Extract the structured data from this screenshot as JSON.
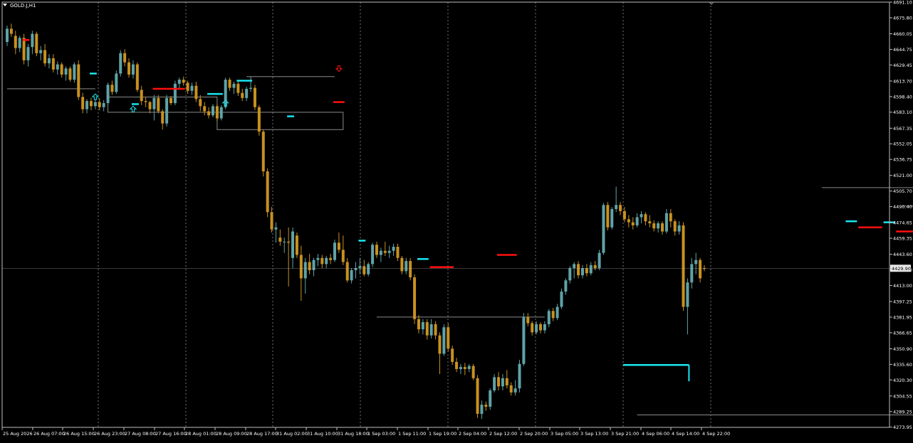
{
  "symbol": "GOLD.J,H1",
  "colors": {
    "background": "#000000",
    "frame": "#c0c0c0",
    "grid": "#c0c0c0",
    "bull": "#5fa3a8",
    "bear": "#c8911f",
    "cyan_level": "#19e6f0",
    "red_level": "#ff1010",
    "box": "#8a8a8a",
    "price_tag_bg": "#e8e8e8",
    "price_tag_text": "#000000",
    "axis_text": "#ffffff"
  },
  "chart_data": {
    "type": "candlestick",
    "title": "GOLD.J,H1",
    "xlabel": "",
    "ylabel": "",
    "ylim": [
      4273.75,
      4691.1
    ],
    "grid": true,
    "y_ticks": [
      "4691.10",
      "4675.80",
      "4660.05",
      "4644.75",
      "4629.45",
      "4613.70",
      "4598.40",
      "4583.10",
      "4567.35",
      "4552.05",
      "4536.75",
      "4521.00",
      "4505.70",
      "4490.40",
      "4474.65",
      "4459.35",
      "4443.60",
      "4428.30",
      "4413.00",
      "4397.25",
      "4381.95",
      "4366.65",
      "4350.90",
      "4335.60",
      "4320.30",
      "4304.55",
      "4289.25",
      "4273.95"
    ],
    "y_tick_values": [
      4691.1,
      4675.8,
      4660.05,
      4644.75,
      4629.45,
      4613.7,
      4598.4,
      4583.1,
      4567.35,
      4552.05,
      4536.75,
      4521.0,
      4505.7,
      4490.4,
      4474.65,
      4459.35,
      4443.6,
      4428.3,
      4413.0,
      4397.25,
      4381.95,
      4366.65,
      4350.9,
      4335.6,
      4320.3,
      4304.55,
      4289.25,
      4273.95
    ],
    "x_ticks": [
      "25 Aug 2026",
      "26 Aug 07:00",
      "26 Aug 15:00",
      "26 Aug 23:00",
      "27 Aug 08:00",
      "27 Aug 16:00",
      "28 Aug 01:00",
      "28 Aug 09:00",
      "28 Aug 17:00",
      "31 Aug 02:00",
      "31 Aug 10:00",
      "31 Aug 18:00",
      "1 Sep 03:00",
      "1 Sep 11:00",
      "1 Sep 19:00",
      "2 Sep 04:00",
      "2 Sep 12:00",
      "2 Sep 20:00",
      "3 Sep 05:00",
      "3 Sep 13:00",
      "3 Sep 21:00",
      "4 Sep 06:00",
      "4 Sep 14:00",
      "4 Sep 22:00"
    ],
    "current_price": "4429.90",
    "current_price_value": 4429.9,
    "candles": [
      [
        4652.0,
        4668.0,
        4648.0,
        4665.0
      ],
      [
        4665.0,
        4670.0,
        4657.0,
        4660.0
      ],
      [
        4658.0,
        4663.0,
        4640.0,
        4646.0
      ],
      [
        4646.0,
        4658.0,
        4642.0,
        4656.0
      ],
      [
        4656.0,
        4660.0,
        4630.0,
        4634.0
      ],
      [
        4634.0,
        4650.0,
        4628.0,
        4647.0
      ],
      [
        4647.0,
        4663.0,
        4640.0,
        4660.0
      ],
      [
        4660.0,
        4662.0,
        4638.0,
        4641.0
      ],
      [
        4641.0,
        4648.0,
        4634.0,
        4644.0
      ],
      [
        4644.0,
        4650.0,
        4628.0,
        4631.0
      ],
      [
        4631.0,
        4640.0,
        4626.0,
        4636.0
      ],
      [
        4636.0,
        4640.0,
        4622.0,
        4625.0
      ],
      [
        4625.0,
        4633.0,
        4620.0,
        4630.0
      ],
      [
        4630.0,
        4632.0,
        4617.0,
        4620.0
      ],
      [
        4620.0,
        4628.0,
        4614.0,
        4626.0
      ],
      [
        4626.0,
        4628.0,
        4613.0,
        4615.0
      ],
      [
        4615.0,
        4632.0,
        4612.0,
        4630.0
      ],
      [
        4630.0,
        4634.0,
        4595.0,
        4598.0
      ],
      [
        4598.0,
        4602.0,
        4582.0,
        4586.0
      ],
      [
        4586.0,
        4596.0,
        4582.0,
        4594.0
      ],
      [
        4594.0,
        4597.0,
        4585.0,
        4589.0
      ],
      [
        4589.0,
        4595.0,
        4586.0,
        4593.0
      ],
      [
        4593.0,
        4597.0,
        4585.0,
        4588.0
      ],
      [
        4588.0,
        4595.0,
        4584.0,
        4592.0
      ],
      [
        4592.0,
        4612.0,
        4590.0,
        4610.0
      ],
      [
        4610.0,
        4614.0,
        4600.0,
        4603.0
      ],
      [
        4603.0,
        4624.0,
        4601.0,
        4621.0
      ],
      [
        4621.0,
        4644.0,
        4618.0,
        4641.0
      ],
      [
        4641.0,
        4645.0,
        4628.0,
        4632.0
      ],
      [
        4632.0,
        4636.0,
        4617.0,
        4620.0
      ],
      [
        4620.0,
        4634.0,
        4616.0,
        4630.0
      ],
      [
        4630.0,
        4632.0,
        4603.0,
        4605.0
      ],
      [
        4605.0,
        4609.0,
        4590.0,
        4594.0
      ],
      [
        4594.0,
        4598.0,
        4588.0,
        4593.0
      ],
      [
        4593.0,
        4594.0,
        4582.0,
        4586.0
      ],
      [
        4586.0,
        4600.0,
        4575.0,
        4597.0
      ],
      [
        4597.0,
        4600.0,
        4582.0,
        4584.0
      ],
      [
        4584.0,
        4586.0,
        4566.0,
        4572.0
      ],
      [
        4572.0,
        4600.0,
        4569.0,
        4597.0
      ],
      [
        4597.0,
        4599.0,
        4590.0,
        4592.0
      ],
      [
        4592.0,
        4614.0,
        4590.0,
        4611.0
      ],
      [
        4611.0,
        4617.0,
        4605.0,
        4615.0
      ],
      [
        4615.0,
        4618.0,
        4609.0,
        4612.0
      ],
      [
        4612.0,
        4614.0,
        4601.0,
        4604.0
      ],
      [
        4604.0,
        4612.0,
        4600.0,
        4609.0
      ],
      [
        4609.0,
        4613.0,
        4593.0,
        4596.0
      ],
      [
        4596.0,
        4600.0,
        4584.0,
        4589.0
      ],
      [
        4589.0,
        4593.0,
        4580.0,
        4584.0
      ],
      [
        4584.0,
        4588.0,
        4577.0,
        4580.0
      ],
      [
        4580.0,
        4591.0,
        4578.0,
        4589.0
      ],
      [
        4589.0,
        4591.0,
        4574.0,
        4577.0
      ],
      [
        4577.0,
        4590.0,
        4575.0,
        4588.0
      ],
      [
        4588.0,
        4617.0,
        4586.0,
        4615.0
      ],
      [
        4615.0,
        4617.0,
        4604.0,
        4607.0
      ],
      [
        4607.0,
        4613.0,
        4601.0,
        4611.0
      ],
      [
        4611.0,
        4614.0,
        4599.0,
        4602.0
      ],
      [
        4602.0,
        4606.0,
        4594.0,
        4597.0
      ],
      [
        4597.0,
        4608.0,
        4594.0,
        4606.0
      ],
      [
        4606.0,
        4618.0,
        4603.0,
        4607.0
      ],
      [
        4607.0,
        4610.0,
        4585.0,
        4588.0
      ],
      [
        4588.0,
        4590.0,
        4560.0,
        4564.0
      ],
      [
        4564.0,
        4566.0,
        4520.0,
        4525.0
      ],
      [
        4525.0,
        4528.0,
        4480.0,
        4485.0
      ],
      [
        4485.0,
        4490.0,
        4465.0,
        4468.0
      ],
      [
        4468.0,
        4475.0,
        4455.0,
        4470.0
      ],
      [
        4460.0,
        4468.0,
        4452.0,
        4456.0
      ],
      [
        4456.0,
        4460.0,
        4445.0,
        4456.0
      ],
      [
        4456.0,
        4470.0,
        4412.0,
        4455.0
      ],
      [
        4440.0,
        4470.0,
        4430.0,
        4466.0
      ],
      [
        4462.0,
        4465.0,
        4440.0,
        4443.0
      ],
      [
        4443.0,
        4452.0,
        4398.0,
        4420.0
      ],
      [
        4420.0,
        4440.0,
        4405.0,
        4436.0
      ],
      [
        4436.0,
        4444.0,
        4424.0,
        4428.0
      ],
      [
        4428.0,
        4440.0,
        4422.0,
        4438.0
      ],
      [
        4438.0,
        4444.0,
        4432.0,
        4440.0
      ],
      [
        4440.0,
        4443.0,
        4430.0,
        4434.0
      ],
      [
        4434.0,
        4442.0,
        4430.0,
        4440.0
      ],
      [
        4440.0,
        4444.0,
        4434.0,
        4438.0
      ],
      [
        4438.0,
        4458.0,
        4436.0,
        4455.0
      ],
      [
        4455.0,
        4465.0,
        4445.0,
        4448.0
      ],
      [
        4448.0,
        4462.0,
        4433.0,
        4436.0
      ],
      [
        4436.0,
        4440.0,
        4416.0,
        4418.0
      ],
      [
        4418.0,
        4430.0,
        4415.0,
        4428.0
      ],
      [
        4428.0,
        4436.0,
        4420.0,
        4430.0
      ],
      [
        4430.0,
        4440.0,
        4424.0,
        4432.0
      ],
      [
        4432.0,
        4438.0,
        4422.0,
        4424.0
      ],
      [
        4424.0,
        4436.0,
        4422.0,
        4434.0
      ],
      [
        4434.0,
        4455.0,
        4431.0,
        4453.0
      ],
      [
        4453.0,
        4456.0,
        4440.0,
        4443.0
      ],
      [
        4443.0,
        4450.0,
        4436.0,
        4447.0
      ],
      [
        4447.0,
        4456.0,
        4442.0,
        4445.0
      ],
      [
        4445.0,
        4452.0,
        4440.0,
        4447.0
      ],
      [
        4447.0,
        4454.0,
        4442.0,
        4451.0
      ],
      [
        4451.0,
        4454.0,
        4437.0,
        4440.0
      ],
      [
        4440.0,
        4442.0,
        4424.0,
        4427.0
      ],
      [
        4427.0,
        4440.0,
        4424.0,
        4437.0
      ],
      [
        4437.0,
        4440.0,
        4418.0,
        4421.0
      ],
      [
        4421.0,
        4424.0,
        4375.0,
        4380.0
      ],
      [
        4380.0,
        4384.0,
        4366.0,
        4370.0
      ],
      [
        4370.0,
        4380.0,
        4365.0,
        4377.0
      ],
      [
        4377.0,
        4380.0,
        4360.0,
        4364.0
      ],
      [
        4364.0,
        4380.0,
        4361.0,
        4375.0
      ],
      [
        4375.0,
        4378.0,
        4360.0,
        4364.0
      ],
      [
        4364.0,
        4367.0,
        4326.0,
        4346.0
      ],
      [
        4346.0,
        4375.0,
        4344.0,
        4372.0
      ],
      [
        4372.0,
        4376.0,
        4348.0,
        4351.0
      ],
      [
        4351.0,
        4354.0,
        4335.0,
        4338.0
      ],
      [
        4338.0,
        4342.0,
        4328.0,
        4331.0
      ],
      [
        4331.0,
        4336.0,
        4326.0,
        4333.0
      ],
      [
        4333.0,
        4337.0,
        4325.0,
        4331.0
      ],
      [
        4331.0,
        4336.0,
        4328.0,
        4334.0
      ],
      [
        4334.0,
        4336.0,
        4320.0,
        4322.0
      ],
      [
        4322.0,
        4325.0,
        4283.0,
        4287.0
      ],
      [
        4287.0,
        4300.0,
        4282.0,
        4296.0
      ],
      [
        4296.0,
        4299.0,
        4290.0,
        4294.0
      ],
      [
        4294.0,
        4312.0,
        4291.0,
        4310.0
      ],
      [
        4310.0,
        4326.0,
        4308.0,
        4323.0
      ],
      [
        4323.0,
        4328.0,
        4310.0,
        4314.0
      ],
      [
        4314.0,
        4326.0,
        4310.0,
        4322.0
      ],
      [
        4322.0,
        4330.0,
        4312.0,
        4315.0
      ],
      [
        4315.0,
        4318.0,
        4305.0,
        4308.0
      ],
      [
        4308.0,
        4320.0,
        4305.0,
        4312.0
      ],
      [
        4312.0,
        4340.0,
        4308.0,
        4336.0
      ],
      [
        4336.0,
        4386.0,
        4334.0,
        4382.0
      ],
      [
        4382.0,
        4386.0,
        4373.0,
        4376.0
      ],
      [
        4376.0,
        4378.0,
        4364.0,
        4367.0
      ],
      [
        4367.0,
        4378.0,
        4365.0,
        4375.0
      ],
      [
        4375.0,
        4377.0,
        4366.0,
        4369.0
      ],
      [
        4369.0,
        4378.0,
        4366.0,
        4375.0
      ],
      [
        4375.0,
        4390.0,
        4372.0,
        4388.0
      ],
      [
        4388.0,
        4391.0,
        4378.0,
        4381.0
      ],
      [
        4381.0,
        4395.0,
        4379.0,
        4392.0
      ],
      [
        4392.0,
        4410.0,
        4390.0,
        4407.0
      ],
      [
        4407.0,
        4420.0,
        4404.0,
        4418.0
      ],
      [
        4418.0,
        4432.0,
        4415.0,
        4430.0
      ],
      [
        4430.0,
        4436.0,
        4420.0,
        4434.0
      ],
      [
        4434.0,
        4437.0,
        4420.0,
        4423.0
      ],
      [
        4423.0,
        4433.0,
        4420.0,
        4430.0
      ],
      [
        4430.0,
        4434.0,
        4422.0,
        4425.0
      ],
      [
        4425.0,
        4436.0,
        4423.0,
        4433.0
      ],
      [
        4433.0,
        4437.0,
        4428.0,
        4430.0
      ],
      [
        4430.0,
        4448.0,
        4428.0,
        4445.0
      ],
      [
        4445.0,
        4494.0,
        4443.0,
        4492.0
      ],
      [
        4492.0,
        4495.0,
        4467.0,
        4470.0
      ],
      [
        4470.0,
        4490.0,
        4468.0,
        4488.0
      ],
      [
        4488.0,
        4510.0,
        4485.0,
        4492.0
      ],
      [
        4492.0,
        4495.0,
        4482.0,
        4486.0
      ],
      [
        4486.0,
        4490.0,
        4475.0,
        4478.0
      ],
      [
        4478.0,
        4482.0,
        4470.0,
        4475.0
      ],
      [
        4475.0,
        4480.0,
        4468.0,
        4472.0
      ],
      [
        4472.0,
        4484.0,
        4470.0,
        4480.0
      ],
      [
        4480.0,
        4486.0,
        4474.0,
        4483.0
      ],
      [
        4483.0,
        4485.0,
        4472.0,
        4476.0
      ],
      [
        4476.0,
        4482.0,
        4470.0,
        4474.0
      ],
      [
        4474.0,
        4477.0,
        4466.0,
        4469.0
      ],
      [
        4469.0,
        4476.0,
        4465.0,
        4474.0
      ],
      [
        4474.0,
        4476.0,
        4463.0,
        4466.0
      ],
      [
        4466.0,
        4488.0,
        4464.0,
        4484.0
      ],
      [
        4484.0,
        4488.0,
        4470.0,
        4476.0
      ],
      [
        4476.0,
        4478.0,
        4462.0,
        4466.0
      ],
      [
        4466.0,
        4476.0,
        4463.0,
        4472.0
      ],
      [
        4472.0,
        4475.0,
        4388.0,
        4392.0
      ],
      [
        4392.0,
        4420.0,
        4365.0,
        4416.0
      ],
      [
        4416.0,
        4440.0,
        4410.0,
        4434.0
      ],
      [
        4434.0,
        4445.0,
        4424.0,
        4438.0
      ],
      [
        4438.0,
        4440.0,
        4416.0,
        4420.0
      ],
      [
        4430.0,
        4433.0,
        4427.0,
        4429.9
      ]
    ],
    "cyan_levels": [
      {
        "price": 4621.0,
        "from": 20,
        "to": 21
      },
      {
        "price": 4591.0,
        "from": 30,
        "to": 31
      },
      {
        "price": 4601.0,
        "from": 48,
        "to": 51
      },
      {
        "price": 4614.0,
        "from": 55,
        "to": 58
      },
      {
        "price": 4579.0,
        "from": 67,
        "to": 68
      },
      {
        "price": 4457.0,
        "from": 84,
        "to": 85
      },
      {
        "price": 4439.0,
        "from": 98,
        "to": 100
      },
      {
        "price": 4335.0,
        "from": 147,
        "to": 162
      },
      {
        "price": 4476.0,
        "from": 200,
        "to": 202
      },
      {
        "price": 4475.0,
        "from": 209,
        "to": 211
      }
    ],
    "red_levels": [
      {
        "price": 4654.0,
        "from": 4,
        "to": 5
      },
      {
        "price": 4606.0,
        "from": 35,
        "to": 42
      },
      {
        "price": 4593.0,
        "from": 78,
        "to": 80
      },
      {
        "price": 4431.0,
        "from": 101,
        "to": 106
      },
      {
        "price": 4443.0,
        "from": 117,
        "to": 121
      },
      {
        "price": 4470.0,
        "from": 203,
        "to": 208
      },
      {
        "price": 4466.0,
        "from": 212,
        "to": 217
      }
    ],
    "boxes": [
      {
        "x1": 0,
        "x2": 21,
        "y1": 4606.0,
        "y2": 4606.0
      },
      {
        "x1": 24,
        "x2": 50,
        "y1": 4598.0,
        "y2": 4583.0
      },
      {
        "x1": 50,
        "x2": 80,
        "y1": 4583.0,
        "y2": 4566.0
      },
      {
        "x1": 57,
        "x2": 78,
        "y1": 4618.0,
        "y2": 4618.0
      },
      {
        "x1": 88,
        "x2": 128,
        "y1": 4382.0,
        "y2": 4382.0
      },
      {
        "x1": 150,
        "x2": 228,
        "y1": 4286.0,
        "y2": 4286.0
      },
      {
        "x1": 194,
        "x2": 228,
        "y1": 4509.0,
        "y2": 4509.0
      },
      {
        "x1": 213,
        "x2": 228,
        "y1": 4491.0,
        "y2": 4491.0
      }
    ],
    "up_arrows": [
      {
        "index": 21,
        "price": 4601.0
      },
      {
        "index": 30,
        "price": 4589.0
      },
      {
        "index": 52,
        "price": 4595.0
      }
    ],
    "down_arrows": [
      {
        "index": 79,
        "price": 4623.0
      }
    ]
  }
}
